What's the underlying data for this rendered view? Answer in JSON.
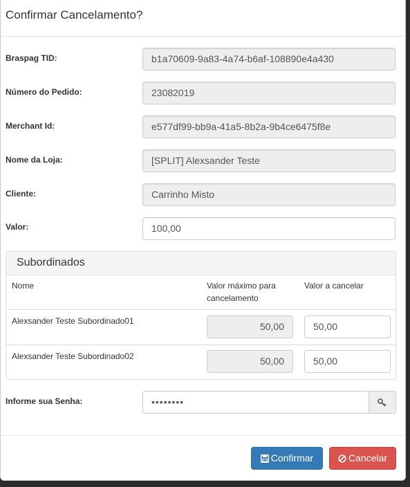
{
  "modal": {
    "title": "Confirmar Cancelamento?"
  },
  "fields": {
    "tid": {
      "label": "Braspag TID:",
      "value": "b1a70609-9a83-4a74-b6af-108890e4a430"
    },
    "pedido": {
      "label": "Número do Pedido:",
      "value": "23082019"
    },
    "merchant": {
      "label": "Merchant Id:",
      "value": "e577df99-bb9a-41a5-8b2a-9b4ce6475f8e"
    },
    "loja": {
      "label": "Nome da Loja:",
      "value": "[SPLIT] Alexsander Teste"
    },
    "cliente": {
      "label": "Cliente:",
      "value": "Carrinho Misto"
    },
    "valor": {
      "label": "Valor:",
      "value": "100,00"
    }
  },
  "subordinados": {
    "title": "Subordinados",
    "headers": {
      "nome": "Nome",
      "max": "Valor máximo para cancelamento",
      "cancel": "Valor a cancelar"
    },
    "rows": [
      {
        "nome": "Alexsander Teste Subordinado01",
        "max": "50,00",
        "cancel": "50,00"
      },
      {
        "nome": "Alexsander Teste Subordinado02",
        "max": "50,00",
        "cancel": "50,00"
      }
    ]
  },
  "senha": {
    "label": "Informe sua Senha:",
    "value": "••••••••",
    "addon_icon": "key-icon"
  },
  "buttons": {
    "confirm": "Confirmar",
    "cancel": "Cancelar",
    "confirm_icon": "save-icon",
    "cancel_icon": "ban-icon"
  },
  "colors": {
    "primary": "#337ab7",
    "danger": "#d9534f",
    "readonly_bg": "#eeeeee"
  }
}
